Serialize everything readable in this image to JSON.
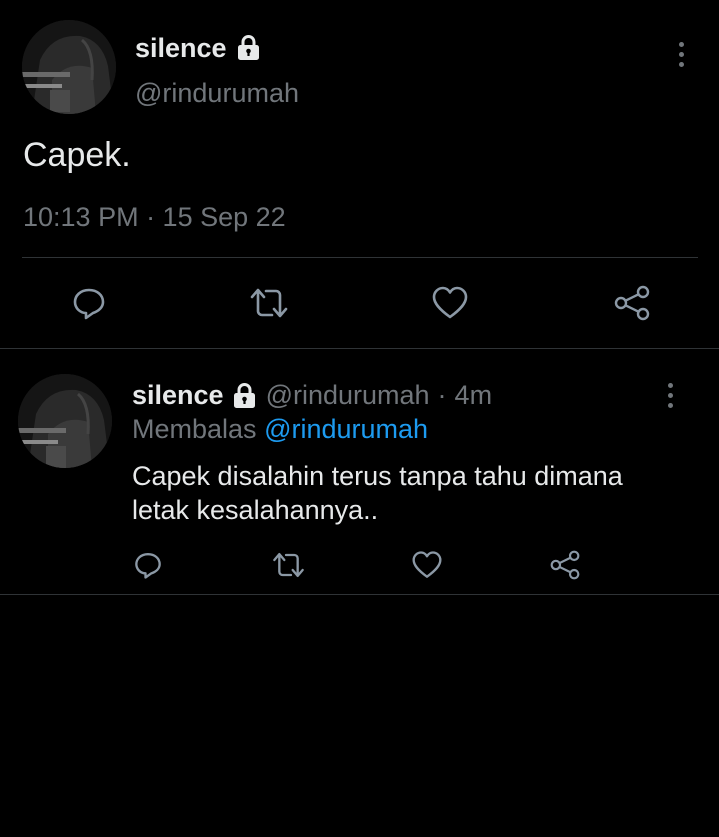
{
  "main_tweet": {
    "display_name": "silence",
    "handle": "@rindurumah",
    "text": "Capek.",
    "timestamp": "10:13 PM · 15 Sep 22"
  },
  "reply_tweet": {
    "display_name": "silence",
    "handle": "@rindurumah",
    "separator": "·",
    "age": "4m",
    "replying_prefix": "Membalas",
    "replying_to": "@rindurumah",
    "text_line1": "Capek disalahin terus tanpa tahu dimana",
    "text_line2": "letak kesalahannya.."
  },
  "icons": {
    "lock": "lock-icon",
    "more": "more-vertical-icon",
    "reply": "reply-icon",
    "retweet": "retweet-icon",
    "like": "heart-icon",
    "share": "share-icon"
  },
  "colors": {
    "background": "#000000",
    "text": "#e7e9ea",
    "secondary_text": "#71767b",
    "accent": "#1d9bf0",
    "divider": "#2f3336"
  }
}
